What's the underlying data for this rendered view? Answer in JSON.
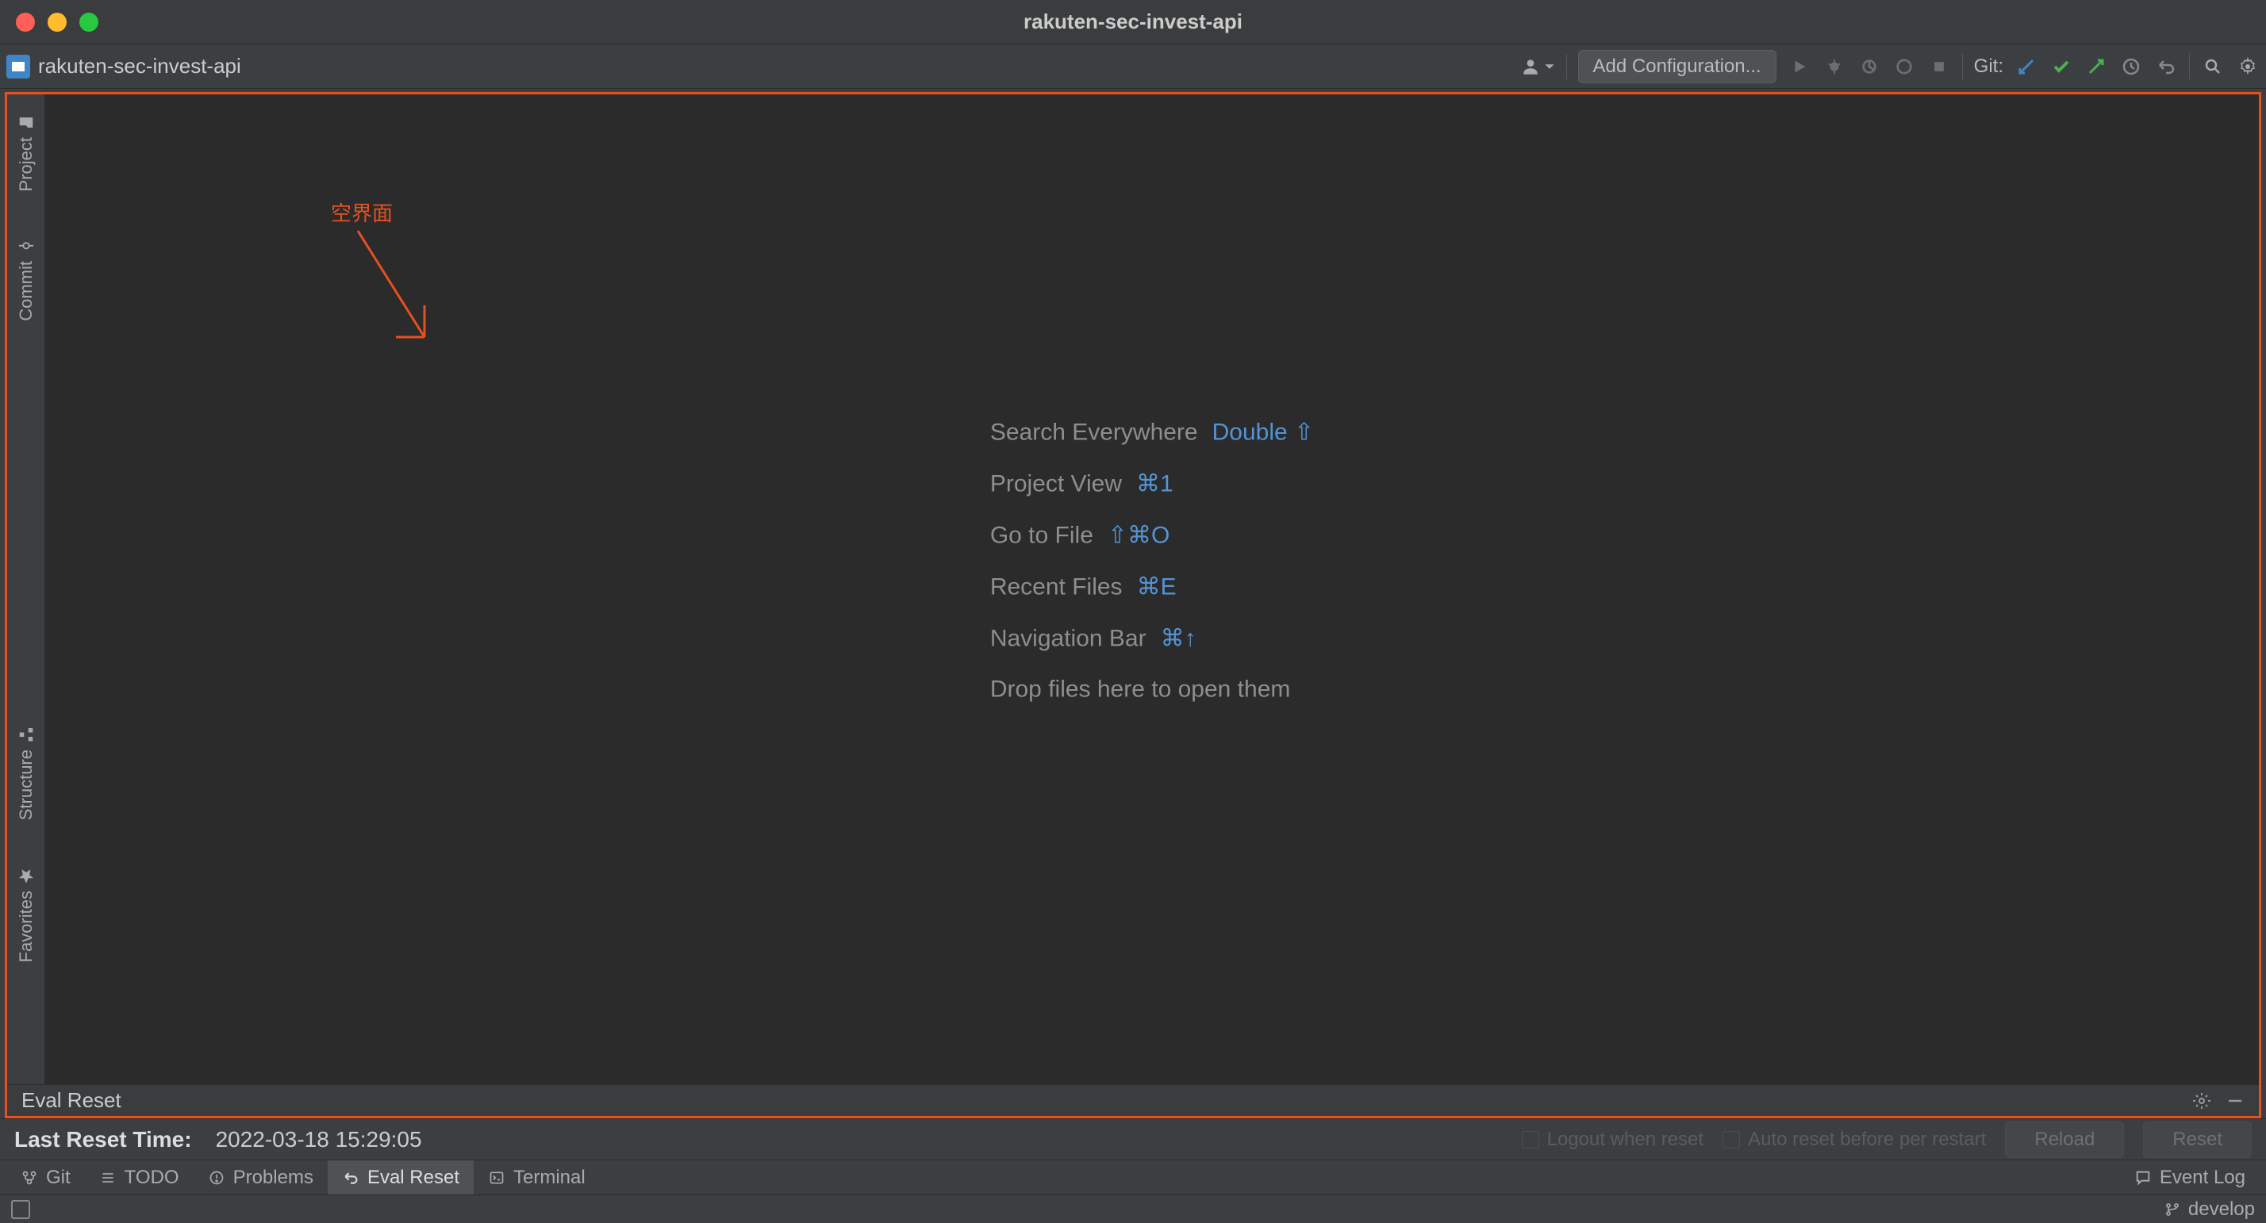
{
  "window": {
    "title": "rakuten-sec-invest-api"
  },
  "navbar": {
    "project_name": "rakuten-sec-invest-api",
    "add_configuration": "Add Configuration...",
    "git_label": "Git:"
  },
  "left_tabs": {
    "project": "Project",
    "commit": "Commit",
    "structure": "Structure",
    "favorites": "Favorites"
  },
  "annotation": {
    "label": "空界面"
  },
  "shortcuts": {
    "search_everywhere": {
      "label": "Search Everywhere",
      "key": "Double ⇧"
    },
    "project_view": {
      "label": "Project View",
      "key": "⌘1"
    },
    "go_to_file": {
      "label": "Go to File",
      "key": "⇧⌘O"
    },
    "recent_files": {
      "label": "Recent Files",
      "key": "⌘E"
    },
    "navigation_bar": {
      "label": "Navigation Bar",
      "key": "⌘↑"
    },
    "drop_hint": "Drop files here to open them"
  },
  "eval_panel": {
    "title": "Eval Reset",
    "last_reset_label": "Last Reset Time:",
    "last_reset_time": "2022-03-18 15:29:05",
    "logout_label": "Logout when reset",
    "auto_label": "Auto reset before per restart",
    "reload_btn": "Reload",
    "reset_btn": "Reset"
  },
  "bottom_tabs": {
    "git": "Git",
    "todo": "TODO",
    "problems": "Problems",
    "eval_reset": "Eval Reset",
    "terminal": "Terminal",
    "event_log": "Event Log"
  },
  "statusbar": {
    "branch": "develop"
  }
}
